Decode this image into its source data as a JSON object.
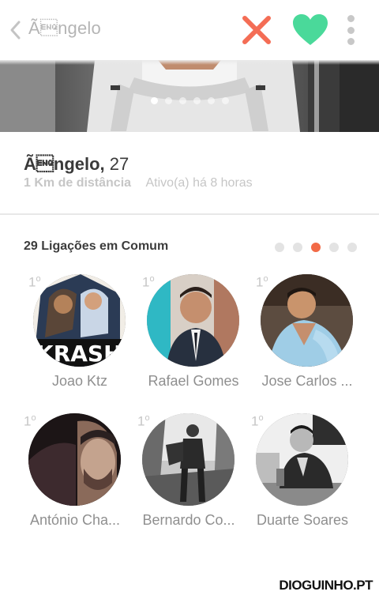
{
  "header": {
    "name": "Ã\u0005ngelo",
    "dislike_icon": "x-icon",
    "dislike_color": "#f46d55",
    "like_icon": "heart-icon",
    "like_color": "#4ad99a",
    "menu_icon": "more-vertical-icon"
  },
  "photo": {
    "dot_count": 6,
    "active_dot": 1
  },
  "profile": {
    "name": "Ã\u0005ngelo,",
    "age": "27",
    "distance": "1 Km de distância",
    "activity": "Ativo(a) há 8 horas"
  },
  "connections": {
    "title": "29 Ligações em Comum",
    "page_count": 5,
    "active_page": 3,
    "accent_color": "#f26a47",
    "items": [
      {
        "name": "Joao Ktz",
        "degree": "1",
        "degree_suffix": "o"
      },
      {
        "name": "Rafael Gomes",
        "degree": "1",
        "degree_suffix": "o"
      },
      {
        "name": "Jose Carlos ...",
        "degree": "1",
        "degree_suffix": "o"
      },
      {
        "name": "António Cha...",
        "degree": "1",
        "degree_suffix": "o"
      },
      {
        "name": "Bernardo Co...",
        "degree": "1",
        "degree_suffix": "o"
      },
      {
        "name": "Duarte Soares",
        "degree": "1",
        "degree_suffix": "o"
      }
    ],
    "avatar_texts": {
      "joao": "KRASH"
    }
  },
  "watermark": "DIOGUINHO.PT"
}
